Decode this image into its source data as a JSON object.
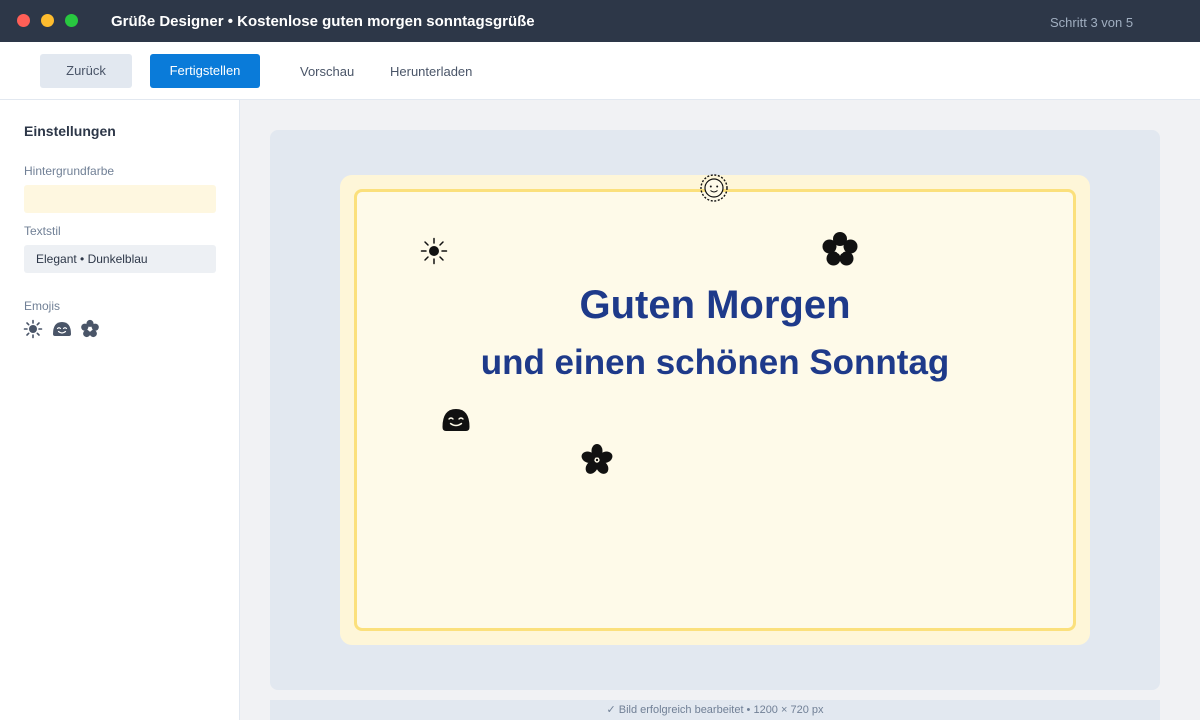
{
  "window": {
    "title": "Grüße Designer • Kostenlose guten morgen sonntagsgrüße",
    "step": "Schritt 3 von 5"
  },
  "toolbar": {
    "back_label": "Zurück",
    "finish_label": "Fertigstellen",
    "preview_label": "Vorschau",
    "download_label": "Herunterladen"
  },
  "sidebar": {
    "title": "Einstellungen",
    "background_label": "Hintergrundfarbe",
    "background_color": "#fef7e0",
    "textstyle_label": "Textstil",
    "textstyle_value": "Elegant • Dunkelblau",
    "emojis_label": "Emojis",
    "emoji_icons": [
      "sun-icon",
      "smile-face-icon",
      "flower-icon"
    ]
  },
  "card": {
    "headline": "Guten Morgen",
    "subline": "und einen schönen Sonntag",
    "text_color": "#1e3a8a",
    "border_color": "#fbe07c",
    "decorations": [
      "sun-face-icon",
      "sun-icon",
      "flower-icon",
      "smile-face-icon",
      "blossom-icon"
    ]
  },
  "status": {
    "text": "✓ Bild erfolgreich bearbeitet • 1200 × 720 px"
  }
}
